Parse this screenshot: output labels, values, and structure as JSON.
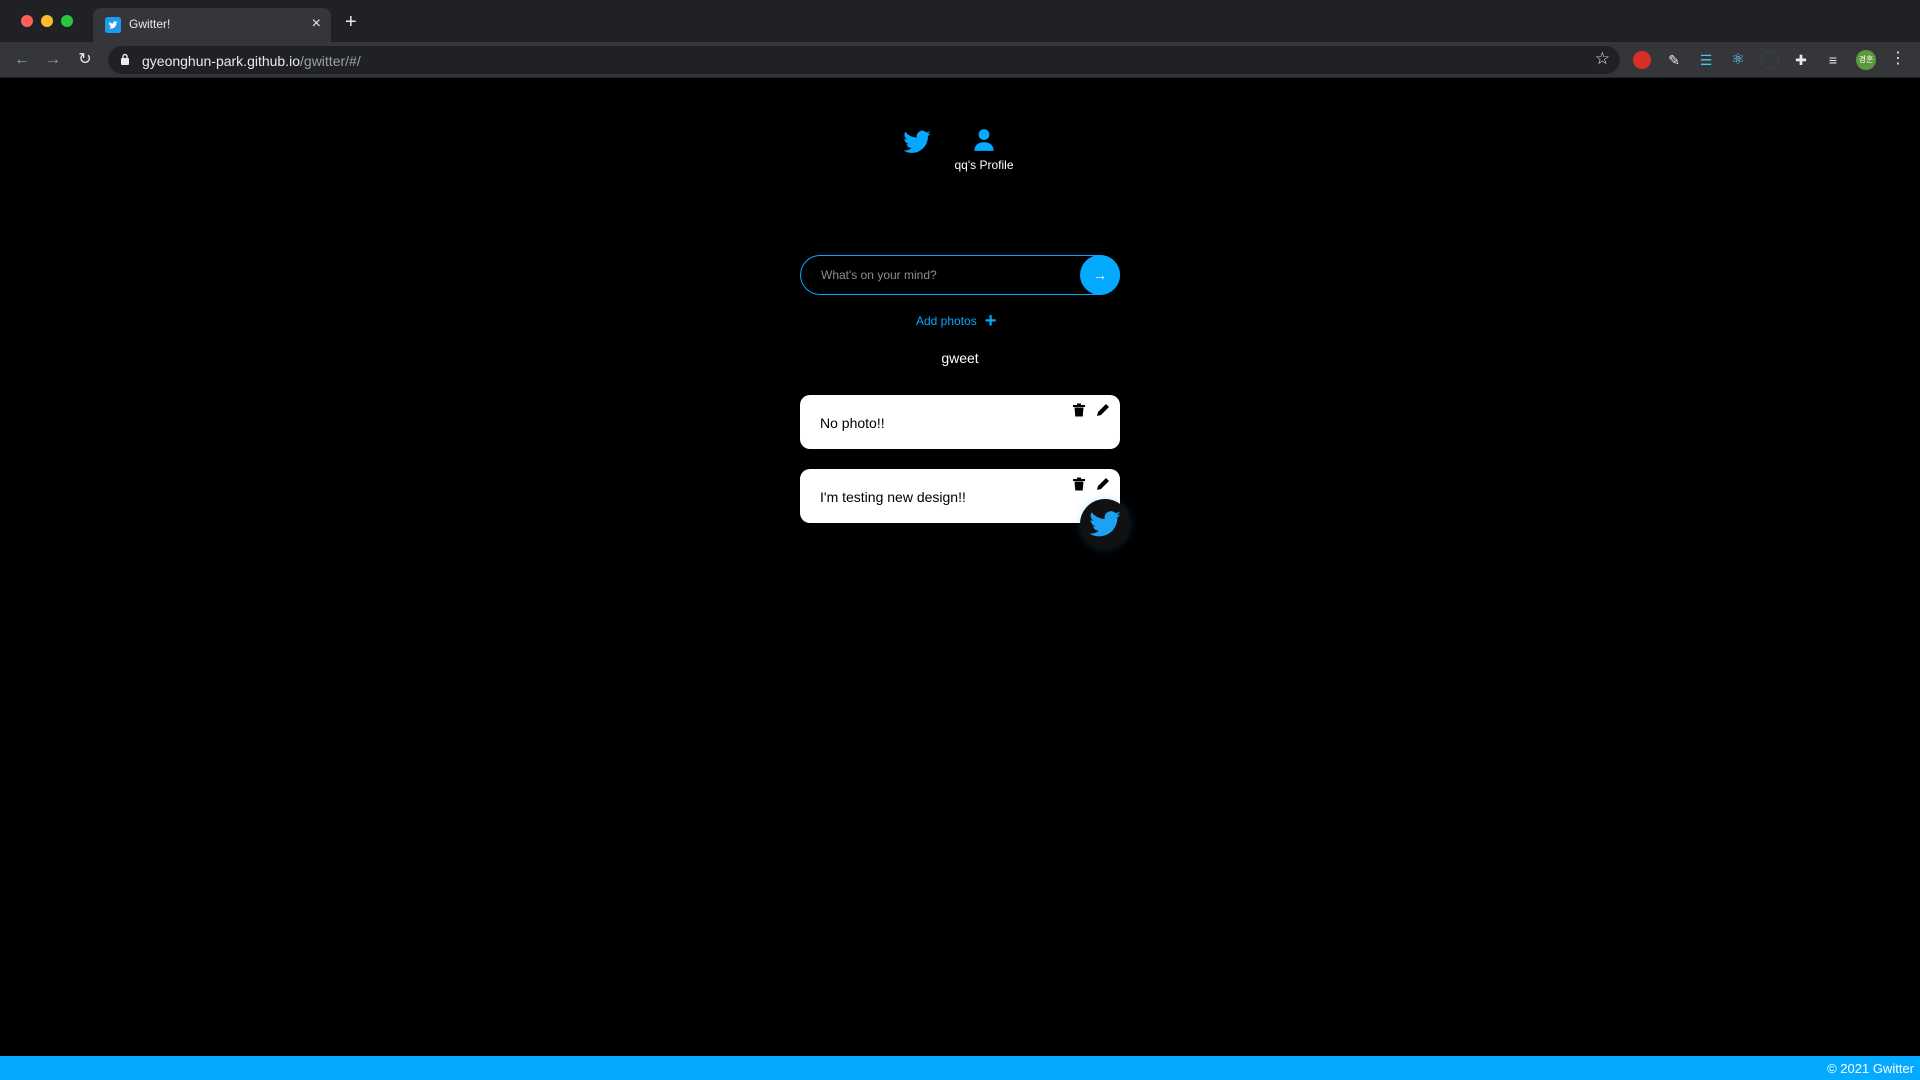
{
  "browser": {
    "tab_title": "Gwitter!",
    "tab_close": "×",
    "new_tab": "+",
    "url_host": "gyeonghun-park.github.io",
    "url_path": "/gwitter/#/",
    "profile_initials": "경훈"
  },
  "nav": {
    "profile_label": "qq's Profile"
  },
  "composer": {
    "placeholder": "What's on your mind?",
    "submit_arrow": "→"
  },
  "add_photos": {
    "label": "Add photos",
    "plus": "+"
  },
  "gweet_button": "gweet",
  "gweets": [
    {
      "text": "No photo!!"
    },
    {
      "text": "I'm testing new design!!"
    }
  ],
  "footer": {
    "text": "© 2021 Gwitter"
  },
  "colors": {
    "accent": "#04aaff",
    "background": "#000000",
    "card": "#ffffff"
  },
  "icons": [
    "twitter-icon",
    "user-icon",
    "arrow-right-icon",
    "plus-icon",
    "trash-icon",
    "pencil-icon"
  ]
}
